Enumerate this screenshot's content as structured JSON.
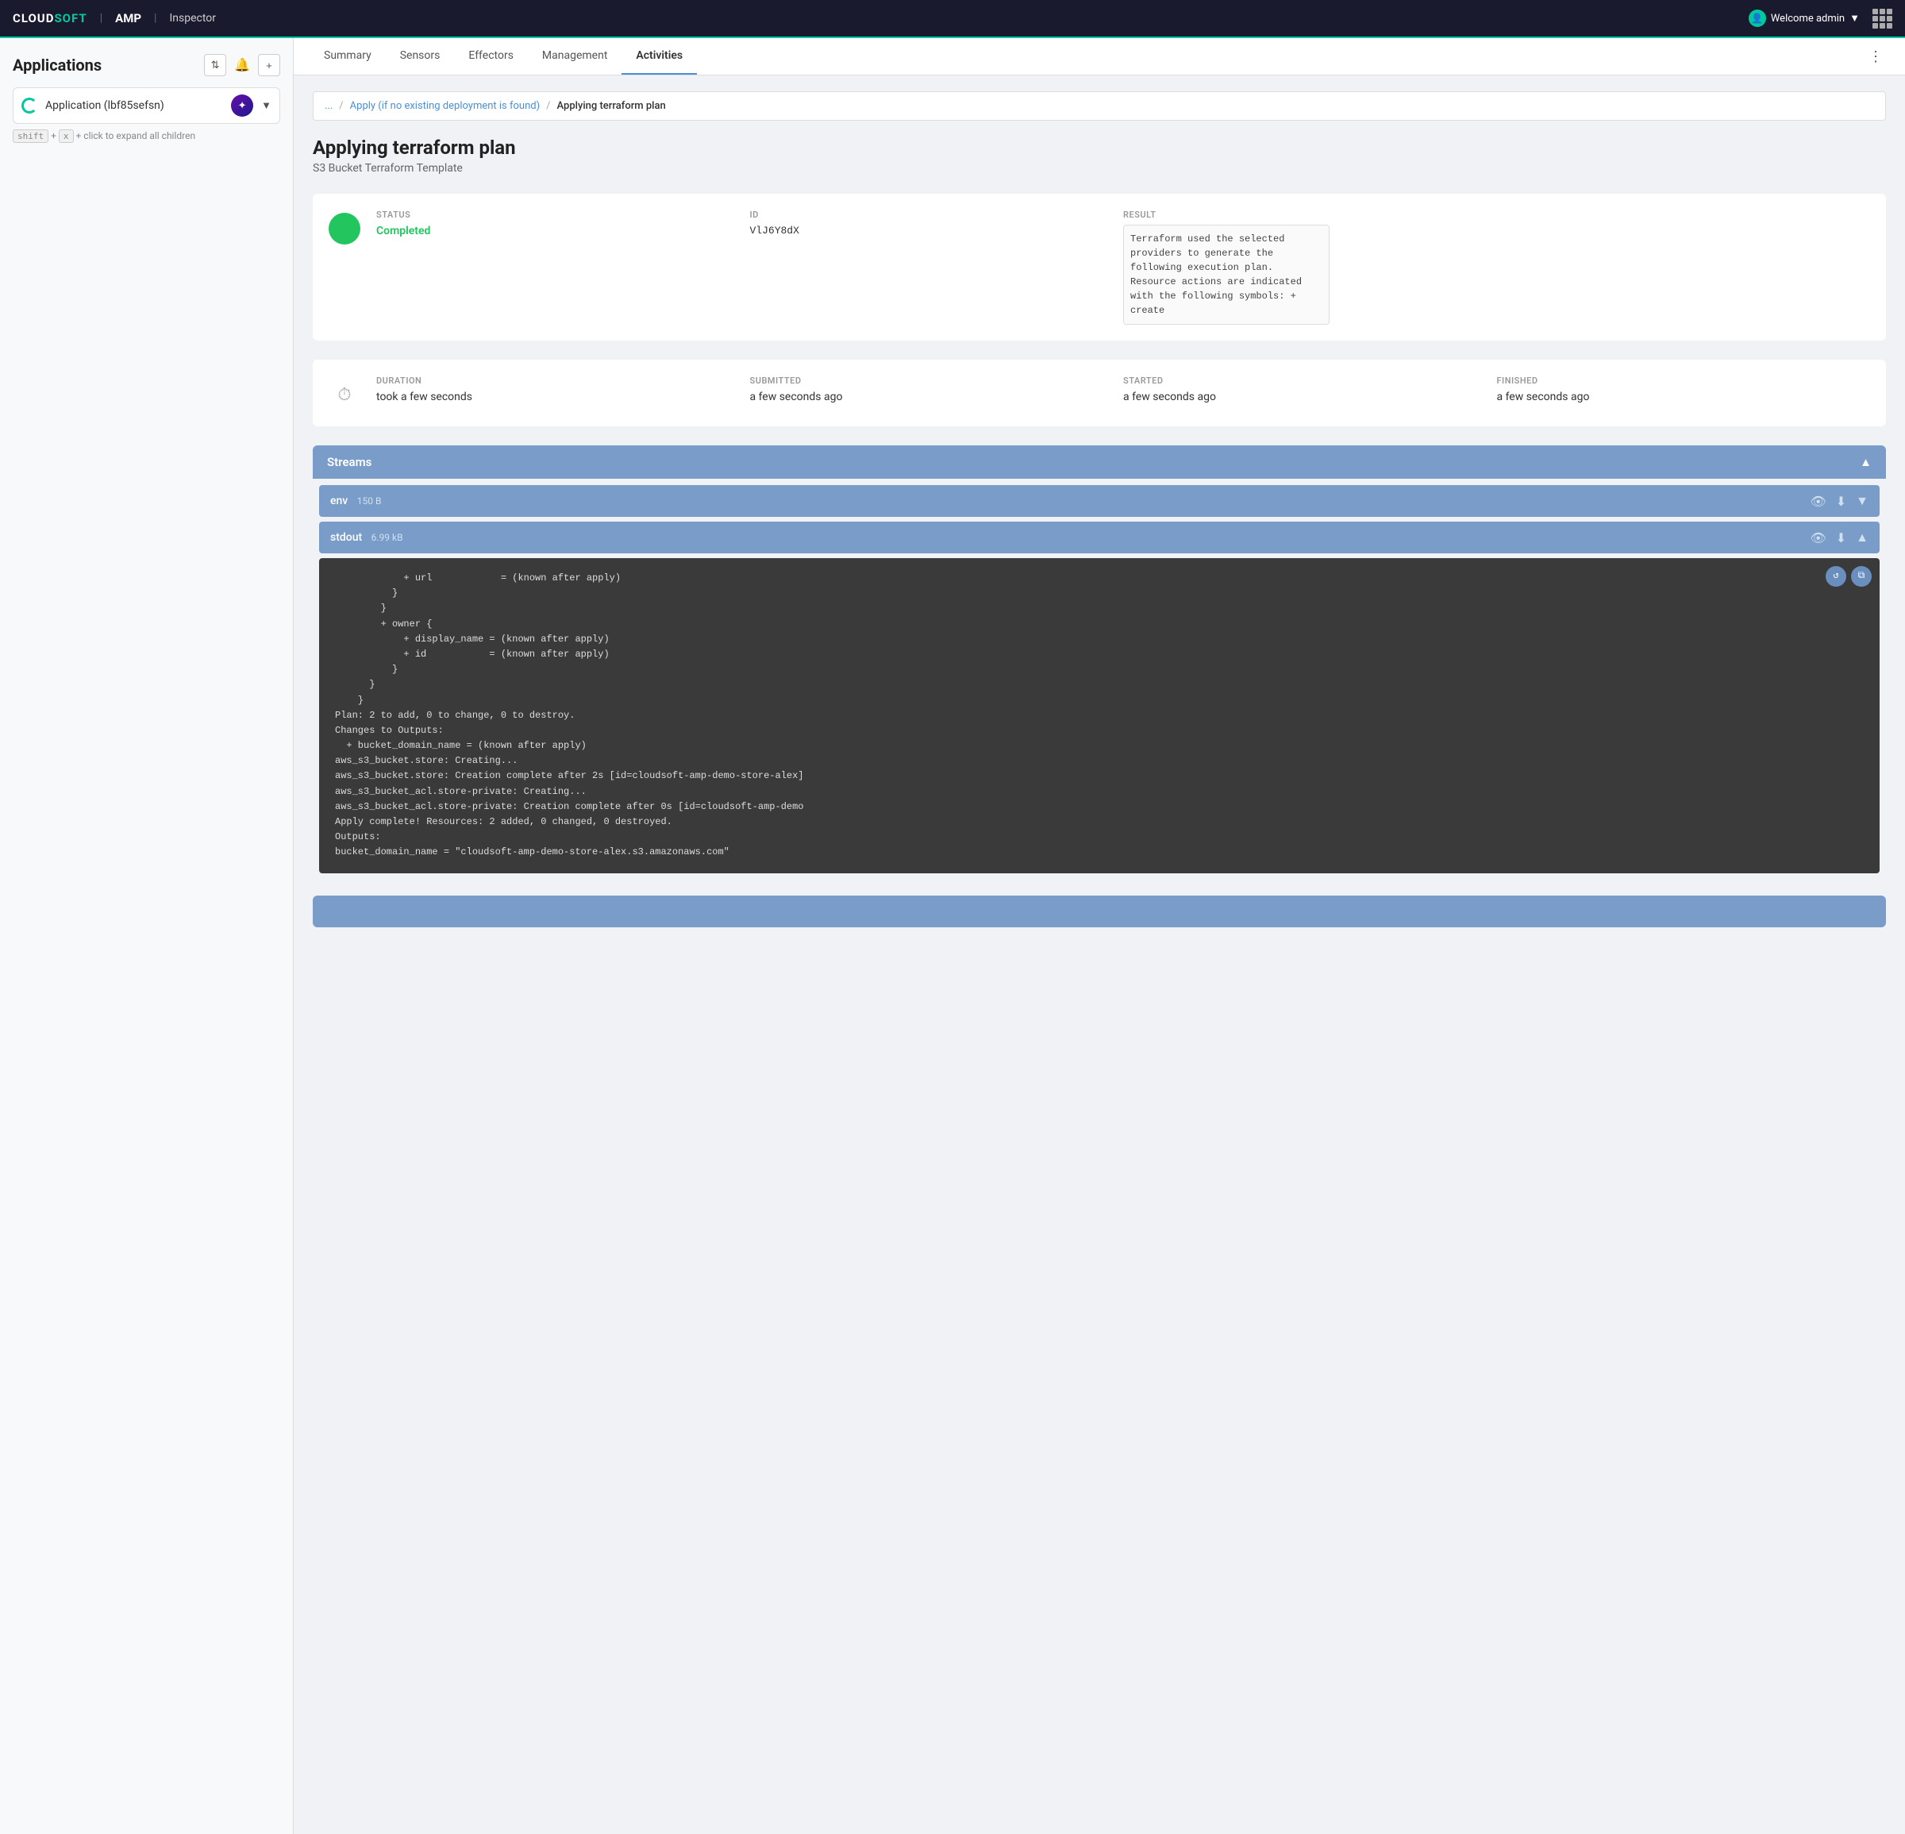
{
  "navbar": {
    "logo": "CLOUDSOFT",
    "divider": "|",
    "amp": "AMP",
    "amp_divider": "|",
    "inspector": "Inspector",
    "user_label": "Welcome admin",
    "user_icon": "👤"
  },
  "sidebar": {
    "title": "Applications",
    "app_name": "Application (lbf85sefsn)",
    "hint_text": "+ click to expand all children",
    "hint_keys": [
      "shift",
      "x"
    ]
  },
  "tabs": {
    "items": [
      {
        "label": "Summary",
        "active": false
      },
      {
        "label": "Sensors",
        "active": false
      },
      {
        "label": "Effectors",
        "active": false
      },
      {
        "label": "Management",
        "active": false
      },
      {
        "label": "Activities",
        "active": true
      }
    ],
    "more_label": "⋮"
  },
  "breadcrumb": {
    "ellipsis": "...",
    "parent": "Apply (if no existing deployment is found)",
    "current": "Applying terraform plan"
  },
  "activity": {
    "title": "Applying terraform plan",
    "subtitle": "S3 Bucket Terraform Template",
    "status_label": "STATUS",
    "status_value": "Completed",
    "id_label": "ID",
    "id_value": "VlJ6Y8dX",
    "result_label": "RESULT",
    "result_text": "Terraform used the selected providers to generate the following execution plan. Resource actions are indicated with the following symbols: + create",
    "duration_label": "DURATION",
    "duration_value": "took a few seconds",
    "submitted_label": "SUBMITTED",
    "submitted_value": "a few seconds ago",
    "started_label": "STARTED",
    "started_value": "a few seconds ago",
    "finished_label": "FINISHED",
    "finished_value": "a few seconds ago"
  },
  "streams": {
    "title": "Streams",
    "items": [
      {
        "name": "env",
        "size": "150 B",
        "expanded": false
      },
      {
        "name": "stdout",
        "size": "6.99 kB",
        "expanded": true
      }
    ]
  },
  "code": {
    "lines": [
      "            + url            = (known after apply)",
      "          }",
      "        }",
      "        + owner {",
      "            + display_name = (known after apply)",
      "            + id           = (known after apply)",
      "          }",
      "      }",
      "    }",
      "",
      "Plan: 2 to add, 0 to change, 0 to destroy.",
      "Changes to Outputs:",
      "  + bucket_domain_name = (known after apply)",
      "aws_s3_bucket.store: Creating...",
      "aws_s3_bucket.store: Creation complete after 2s [id=cloudsoft-amp-demo-store-alex]",
      "aws_s3_bucket_acl.store-private: Creating...",
      "aws_s3_bucket_acl.store-private: Creation complete after 0s [id=cloudsoft-amp-demo",
      "Apply complete! Resources: 2 added, 0 changed, 0 destroyed.",
      "Outputs:",
      "bucket_domain_name = \"cloudsoft-amp-demo-store-alex.s3.amazonaws.com\""
    ]
  }
}
